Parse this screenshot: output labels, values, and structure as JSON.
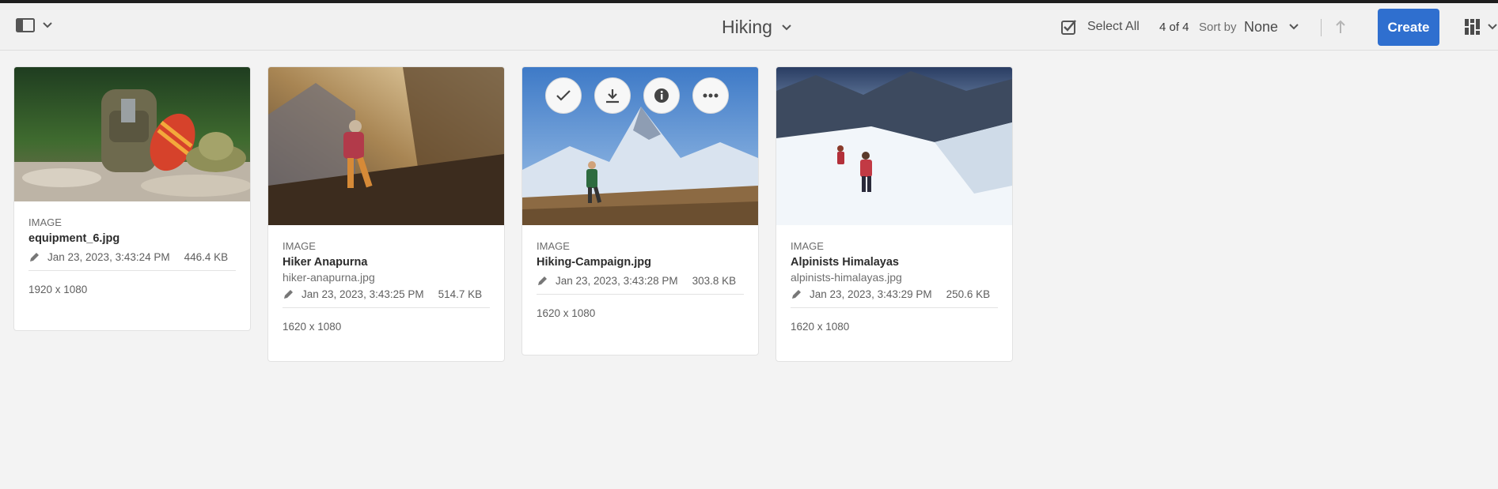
{
  "toolbar": {
    "title": "Hiking",
    "select_all_label": "Select All",
    "count": "4 of 4",
    "sort_by_label": "Sort by",
    "sort_value": "None",
    "create_label": "Create",
    "accent": "#2f6fcf"
  },
  "icons": [
    "sidebar-toggle-icon",
    "chevron-down-icon",
    "select-all-checkbox-icon",
    "sort-direction-arrow-icon",
    "grid-view-icon",
    "check-icon",
    "download-icon",
    "info-icon",
    "more-icon",
    "edit-pencil-icon"
  ],
  "cards": [
    {
      "type": "IMAGE",
      "title": "equipment_6.jpg",
      "filename": "",
      "date": "Jan 23, 2023, 3:43:24 PM",
      "size": "446.4 KB",
      "dims": "1920 x 1080"
    },
    {
      "type": "IMAGE",
      "title": "Hiker Anapurna",
      "filename": "hiker-anapurna.jpg",
      "date": "Jan 23, 2023, 3:43:25 PM",
      "size": "514.7 KB",
      "dims": "1620 x 1080"
    },
    {
      "type": "IMAGE",
      "title": "Hiking-Campaign.jpg",
      "filename": "",
      "date": "Jan 23, 2023, 3:43:28 PM",
      "size": "303.8 KB",
      "dims": "1620 x 1080"
    },
    {
      "type": "IMAGE",
      "title": "Alpinists Himalayas",
      "filename": "alpinists-himalayas.jpg",
      "date": "Jan 23, 2023, 3:43:29 PM",
      "size": "250.6 KB",
      "dims": "1620 x 1080"
    }
  ]
}
